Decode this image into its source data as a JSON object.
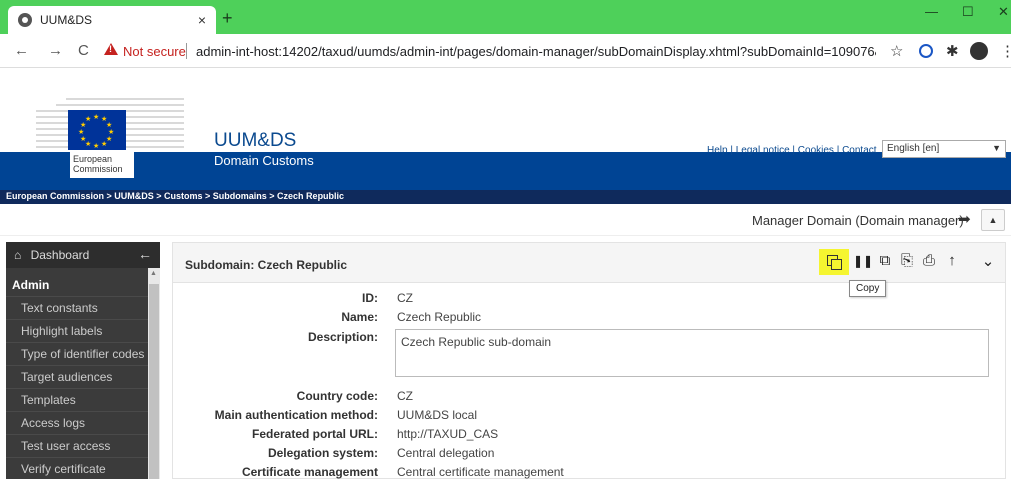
{
  "browser": {
    "tab_title": "UUM&DS",
    "tab_close": "×",
    "new_tab": "+",
    "minimize": "—",
    "maximize": "☐",
    "close": "✕",
    "back": "←",
    "forward": "→",
    "reload": "C",
    "not_secure": "Not secure",
    "url": "admin-int-host:14202/taxud/uumds/admin-int/pages/domain-manager/subDomainDisplay.xhtml?subDomainId=109076&tabIndex...",
    "star": "☆",
    "puzzle": "✱",
    "menu": "⋮"
  },
  "header": {
    "ec_name": "European Commission",
    "app_title": "UUM&DS",
    "subtitle": "Domain Customs",
    "top_links": "Help | Legal notice | Cookies | Contact",
    "language": "English [en]",
    "breadcrumb": "European Commission > UUM&DS > Customs > Subdomains > Czech Republic"
  },
  "userbar": {
    "user": "Manager Domain (Domain manager)",
    "logout_icon": "➡",
    "collapse": "▲"
  },
  "sidebar": {
    "dashboard": "Dashboard",
    "home_icon": "⌂",
    "collapse_arrow": "←",
    "section": "Admin",
    "items": [
      {
        "label": "Text constants"
      },
      {
        "label": "Highlight labels"
      },
      {
        "label": "Type of identifier codes"
      },
      {
        "label": "Target audiences"
      },
      {
        "label": "Templates"
      },
      {
        "label": "Access logs"
      },
      {
        "label": "Test user access"
      },
      {
        "label": "Verify certificate"
      }
    ]
  },
  "panel": {
    "title": "Subdomain: Czech Republic",
    "tooltip": "Copy",
    "icons": {
      "pause": "❚❚",
      "duplicate": "⧉",
      "export": "⎘",
      "print": "⎙",
      "up": "↑",
      "expand": "⌄"
    },
    "fields": [
      {
        "label": "ID:",
        "value": "CZ"
      },
      {
        "label": "Name:",
        "value": "Czech Republic"
      },
      {
        "label": "Description:",
        "value": "Czech Republic sub-domain"
      },
      {
        "label": "Country code:",
        "value": "CZ"
      },
      {
        "label": "Main authentication method:",
        "value": "UUM&DS local"
      },
      {
        "label": "Federated portal URL:",
        "value": "http://TAXUD_CAS"
      },
      {
        "label": "Delegation system:",
        "value": "Central delegation"
      },
      {
        "label": "Certificate management",
        "value": "Central certificate management"
      }
    ]
  },
  "colors": {
    "titlebar": "#4ed05a",
    "ec_blue": "#004494",
    "breadcrumb_bg": "#0f2a5c",
    "sidebar_bg": "#3b3b3b",
    "highlight": "#f5f530",
    "warning": "#c5221f"
  }
}
